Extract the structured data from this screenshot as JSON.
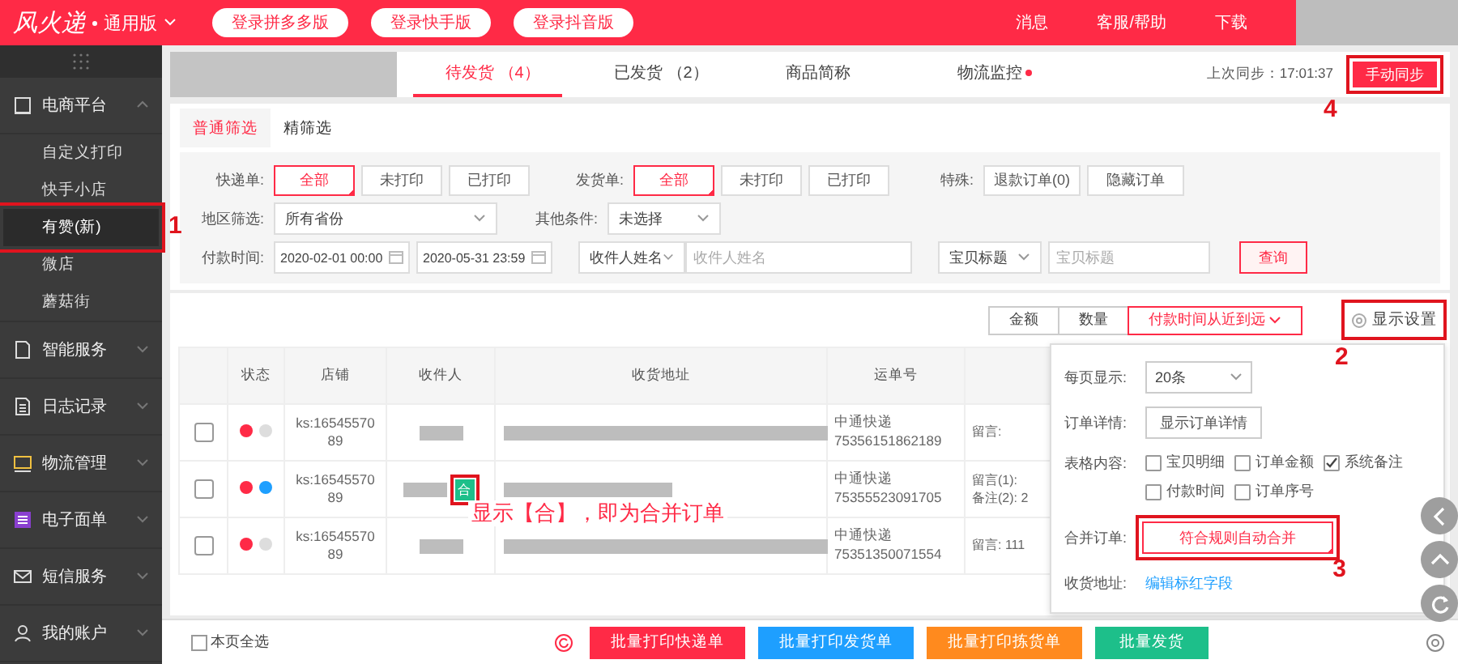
{
  "header": {
    "logo": "风火递",
    "edition": "通用版",
    "login_buttons": [
      "登录拼多多版",
      "登录快手版",
      "登录抖音版"
    ],
    "links": [
      "消息",
      "客服/帮助",
      "下载"
    ]
  },
  "sidebar": {
    "items": [
      {
        "label": "电商平台",
        "expanded": true,
        "children": [
          {
            "label": "自定义打印",
            "selected": false,
            "highlighted": false
          },
          {
            "label": "快手小店",
            "selected": false,
            "highlighted": false
          },
          {
            "label": "有赞(新)",
            "selected": true,
            "highlighted": true,
            "annotation": "1"
          },
          {
            "label": "微店",
            "selected": false,
            "highlighted": false
          },
          {
            "label": "蘑菇街",
            "selected": false,
            "highlighted": false
          }
        ]
      },
      {
        "label": "智能服务",
        "expanded": false
      },
      {
        "label": "日志记录",
        "expanded": false
      },
      {
        "label": "物流管理",
        "expanded": false
      },
      {
        "label": "电子面单",
        "expanded": false
      },
      {
        "label": "短信服务",
        "expanded": false
      },
      {
        "label": "我的账户",
        "expanded": false
      }
    ]
  },
  "tabs": [
    {
      "label": "待发货",
      "count": "（4）",
      "selected": true,
      "dot": false
    },
    {
      "label": "已发货",
      "count": "（2）",
      "selected": false,
      "dot": false
    },
    {
      "label": "商品简称",
      "selected": false,
      "dot": false
    },
    {
      "label": "物流监控",
      "selected": false,
      "dot": true
    }
  ],
  "sync": {
    "text": "上次同步：17:01:37",
    "button": "手动同步",
    "highlighted": true,
    "annotation": "4"
  },
  "filter_tabs": [
    {
      "label": "普通筛选",
      "selected": true
    },
    {
      "label": "精筛选",
      "selected": false
    }
  ],
  "filters": {
    "groups": [
      {
        "label": "快递单:",
        "options": [
          {
            "label": "全部",
            "selected": true
          },
          {
            "label": "未打印",
            "selected": false
          },
          {
            "label": "已打印",
            "selected": false
          }
        ]
      },
      {
        "label": "发货单:",
        "options": [
          {
            "label": "全部",
            "selected": true
          },
          {
            "label": "未打印",
            "selected": false
          },
          {
            "label": "已打印",
            "selected": false
          }
        ]
      },
      {
        "label": "特殊:",
        "options": [
          {
            "label": "退款订单(0)",
            "selected": false
          },
          {
            "label": "隐藏订单",
            "selected": false
          }
        ]
      }
    ],
    "region": {
      "label": "地区筛选:",
      "value": "所有省份"
    },
    "other": {
      "label": "其他条件:",
      "value": "未选择"
    },
    "pay_time": {
      "label": "付款时间:",
      "start": "2020-02-01 00:00",
      "end": "2020-05-31 23:59"
    },
    "recipient": {
      "select": "收件人姓名",
      "placeholder": "收件人姓名"
    },
    "item": {
      "select": "宝贝标题",
      "placeholder": "宝贝标题"
    },
    "query_button": "查询"
  },
  "sort": {
    "buttons": [
      {
        "label": "金额",
        "selected": false
      },
      {
        "label": "数量",
        "selected": false
      },
      {
        "label": "付款时间从近到远",
        "selected": true
      }
    ],
    "settings": {
      "label": "显示设置",
      "highlighted": true,
      "annotation": "2"
    }
  },
  "table": {
    "columns": [
      "状态",
      "店铺",
      "收件人",
      "收货地址",
      "运单号"
    ],
    "rows": [
      {
        "checked": false,
        "status": [
          {
            "color": "#ff2a46"
          },
          {
            "color": "#dddddd"
          }
        ],
        "shop": "ks:1654557089",
        "courier": "中通快递",
        "tracking": "75356151862189",
        "notes": [
          "留言:"
        ]
      },
      {
        "checked": false,
        "status": [
          {
            "color": "#ff2a46"
          },
          {
            "color": "#1e9fff"
          }
        ],
        "shop": "ks:1654557089",
        "merge_badge": "合",
        "badge_highlighted": true,
        "courier": "中通快递",
        "tracking": "75355523091705",
        "notes": [
          "留言(1):",
          "备注(2): 2"
        ]
      },
      {
        "checked": false,
        "status": [
          {
            "color": "#ff2a46"
          },
          {
            "color": "#dddddd"
          }
        ],
        "shop": "ks:1654557089",
        "courier": "中通快递",
        "tracking": "75351350071554",
        "notes": [
          "留言: 111"
        ]
      }
    ],
    "callout": "显示【合】，即为合并订单"
  },
  "settings_popup": {
    "per_page": {
      "label": "每页显示:",
      "value": "20条"
    },
    "detail": {
      "label": "订单详情:",
      "button": "显示订单详情"
    },
    "columns": {
      "label": "表格内容:",
      "options": [
        {
          "label": "宝贝明细",
          "checked": false
        },
        {
          "label": "订单金额",
          "checked": false
        },
        {
          "label": "系统备注",
          "checked": true
        },
        {
          "label": "付款时间",
          "checked": false
        },
        {
          "label": "订单序号",
          "checked": false
        }
      ]
    },
    "merge": {
      "label": "合并订单:",
      "button": "符合规则自动合并",
      "highlighted": true,
      "annotation": "3"
    },
    "address": {
      "label": "收货地址:",
      "link": "编辑标红字段"
    }
  },
  "bottom": {
    "select_all": {
      "label": "本页全选",
      "checked": false
    },
    "buttons": [
      {
        "label": "批量打印快递单",
        "color": "#ff2a46"
      },
      {
        "label": "批量打印发货单",
        "color": "#1e9fff"
      },
      {
        "label": "批量打印拣货单",
        "color": "#ff8a1e"
      },
      {
        "label": "批量发货",
        "color": "#1dbf8a"
      }
    ]
  }
}
